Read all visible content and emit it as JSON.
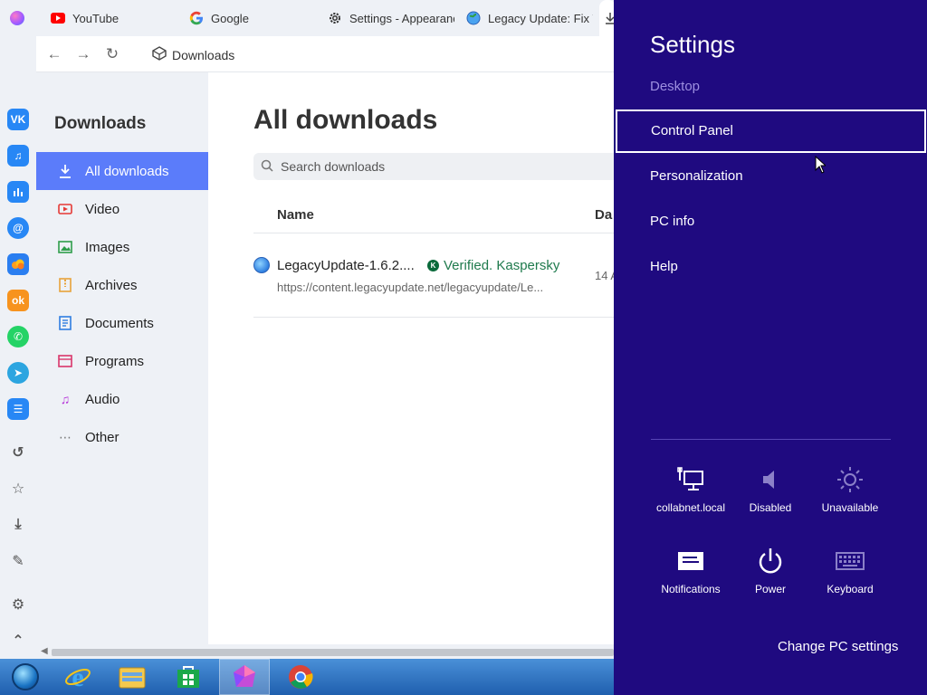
{
  "tabs": [
    {
      "label": "YouTube",
      "icon": "youtube-icon"
    },
    {
      "label": "Google",
      "icon": "google-icon"
    },
    {
      "label": "Settings - Appearanc",
      "icon": "gear-icon"
    },
    {
      "label": "Legacy Update: Fix W",
      "icon": "globe-icon"
    }
  ],
  "address": {
    "text": "Downloads"
  },
  "sidebar_icons": [
    "vk-icon",
    "music-icon",
    "stats-icon",
    "mail-icon",
    "cloud-icon",
    "odnoklassniki-icon",
    "whatsapp-icon",
    "telegram-icon",
    "list-icon",
    "history-icon",
    "star-icon",
    "download-icon",
    "brush-icon",
    "settings-icon",
    "chevron-up-icon"
  ],
  "downloads_nav": {
    "title": "Downloads",
    "items": [
      {
        "label": "All downloads",
        "icon": "download-icon",
        "active": true
      },
      {
        "label": "Video",
        "icon": "video-icon"
      },
      {
        "label": "Images",
        "icon": "image-icon"
      },
      {
        "label": "Archives",
        "icon": "archive-icon"
      },
      {
        "label": "Documents",
        "icon": "document-icon"
      },
      {
        "label": "Programs",
        "icon": "program-icon"
      },
      {
        "label": "Audio",
        "icon": "audio-icon"
      },
      {
        "label": "Other",
        "icon": "more-icon"
      }
    ]
  },
  "main": {
    "title": "All downloads",
    "search_placeholder": "Search downloads",
    "columns": {
      "name": "Name",
      "date": "Da"
    },
    "rows": [
      {
        "name": "LegacyUpdate-1.6.2....",
        "verified": "Verified. Kaspersky",
        "verified_badge": "K",
        "url": "https://content.legacyupdate.net/legacyupdate/Le...",
        "date": "14 A"
      }
    ]
  },
  "taskbar": {
    "items": [
      "start-button",
      "internet-explorer",
      "file-explorer",
      "store",
      "browser",
      "chrome"
    ]
  },
  "charms": {
    "title": "Settings",
    "subtitle": "Desktop",
    "items": [
      "Control Panel",
      "Personalization",
      "PC info",
      "Help"
    ],
    "selected": "Control Panel",
    "tiles": [
      {
        "label": "collabnet.local",
        "icon": "network-icon"
      },
      {
        "label": "Disabled",
        "icon": "volume-icon"
      },
      {
        "label": "Unavailable",
        "icon": "brightness-icon"
      },
      {
        "label": "Notifications",
        "icon": "notifications-icon"
      },
      {
        "label": "Power",
        "icon": "power-icon"
      },
      {
        "label": "Keyboard",
        "icon": "keyboard-icon"
      }
    ],
    "change_settings": "Change PC settings"
  },
  "colors": {
    "accent": "#5b7cfa",
    "charms_bg": "#1f0a80",
    "verified": "#1f7a4d",
    "taskbar": "#2a6fc0"
  }
}
